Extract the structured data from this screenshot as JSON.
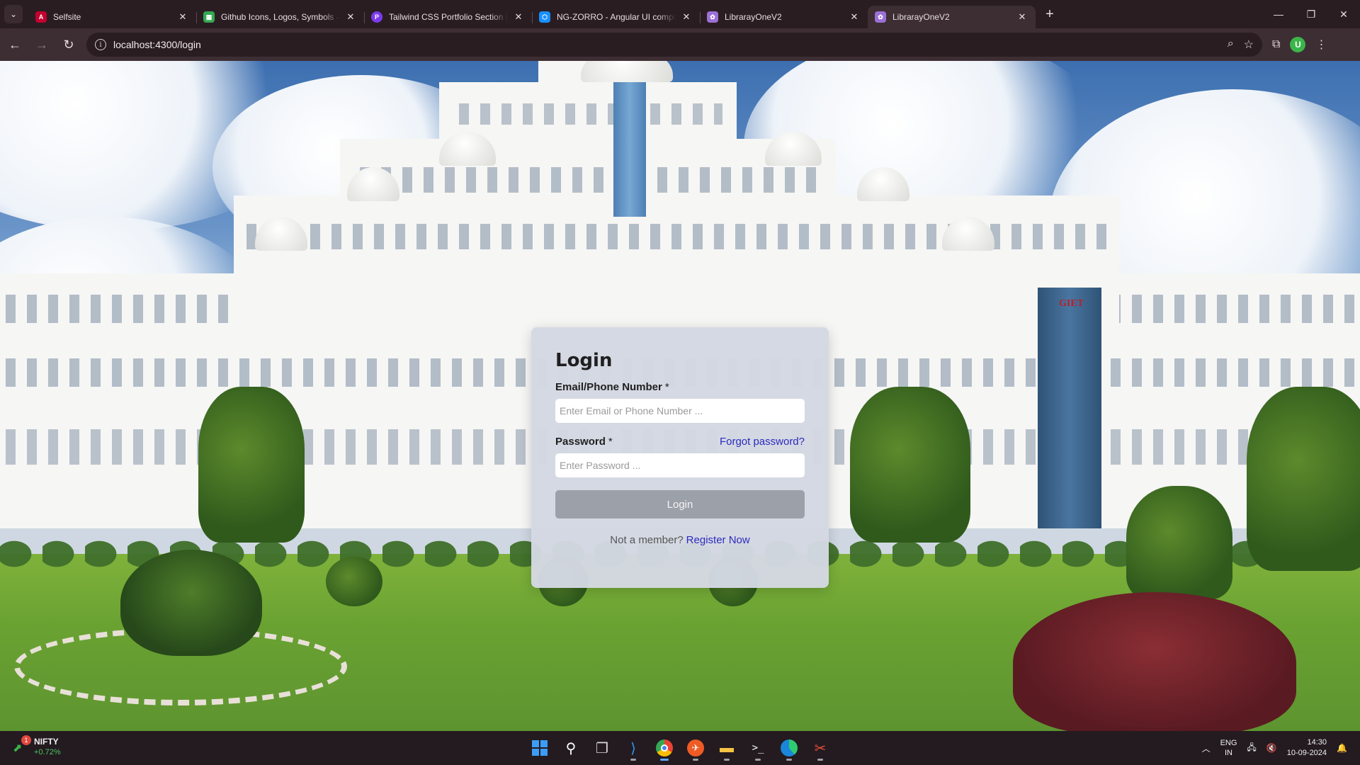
{
  "browser": {
    "tabs": [
      {
        "title": "Selfsite",
        "favicon": "angular-logo-icon",
        "color": "#c3002f"
      },
      {
        "title": "Github Icons, Logos, Symbols -",
        "favicon": "sheets-icon",
        "color": "#34a853"
      },
      {
        "title": "Tailwind CSS Portfolio Section |",
        "favicon": "chat-bubble-icon",
        "color": "#7c3aed"
      },
      {
        "title": "NG-ZORRO - Angular UI compo",
        "favicon": "ng-zorro-icon",
        "color": "#1890ff"
      },
      {
        "title": "LibrarayOneV2",
        "favicon": "app-logo-icon",
        "color": "#9c6fd6"
      },
      {
        "title": "LibrarayOneV2",
        "favicon": "app-logo-icon",
        "color": "#9c6fd6",
        "active": true
      }
    ],
    "address": "localhost:4300/login"
  },
  "login": {
    "title": "Login",
    "email_label": "Email/Phone Number",
    "email_placeholder": "Enter Email or Phone Number ...",
    "email_value": "",
    "required_mark": "*",
    "password_label": "Password",
    "password_placeholder": "Enter Password ...",
    "password_value": "",
    "forgot_link": "Forgot password?",
    "submit_label": "Login",
    "register_prompt": "Not a member?",
    "register_link": "Register Now"
  },
  "background": {
    "sign_text": "GIET"
  },
  "taskbar": {
    "widget_name": "NIFTY",
    "widget_change": "+0.72%",
    "widget_badge": "1",
    "apps": [
      "windows-start-icon",
      "search-icon",
      "task-view-icon",
      "vscode-icon",
      "chrome-icon",
      "postman-icon",
      "file-explorer-icon",
      "terminal-icon",
      "edge-icon",
      "snipping-tool-icon"
    ],
    "lang_top": "ENG",
    "lang_bottom": "IN",
    "time": "14:30",
    "date": "10-09-2024"
  },
  "colors": {
    "link": "#2c2ac0",
    "button_disabled": "#9ca0a8",
    "browser_frame": "#2a1d22"
  }
}
